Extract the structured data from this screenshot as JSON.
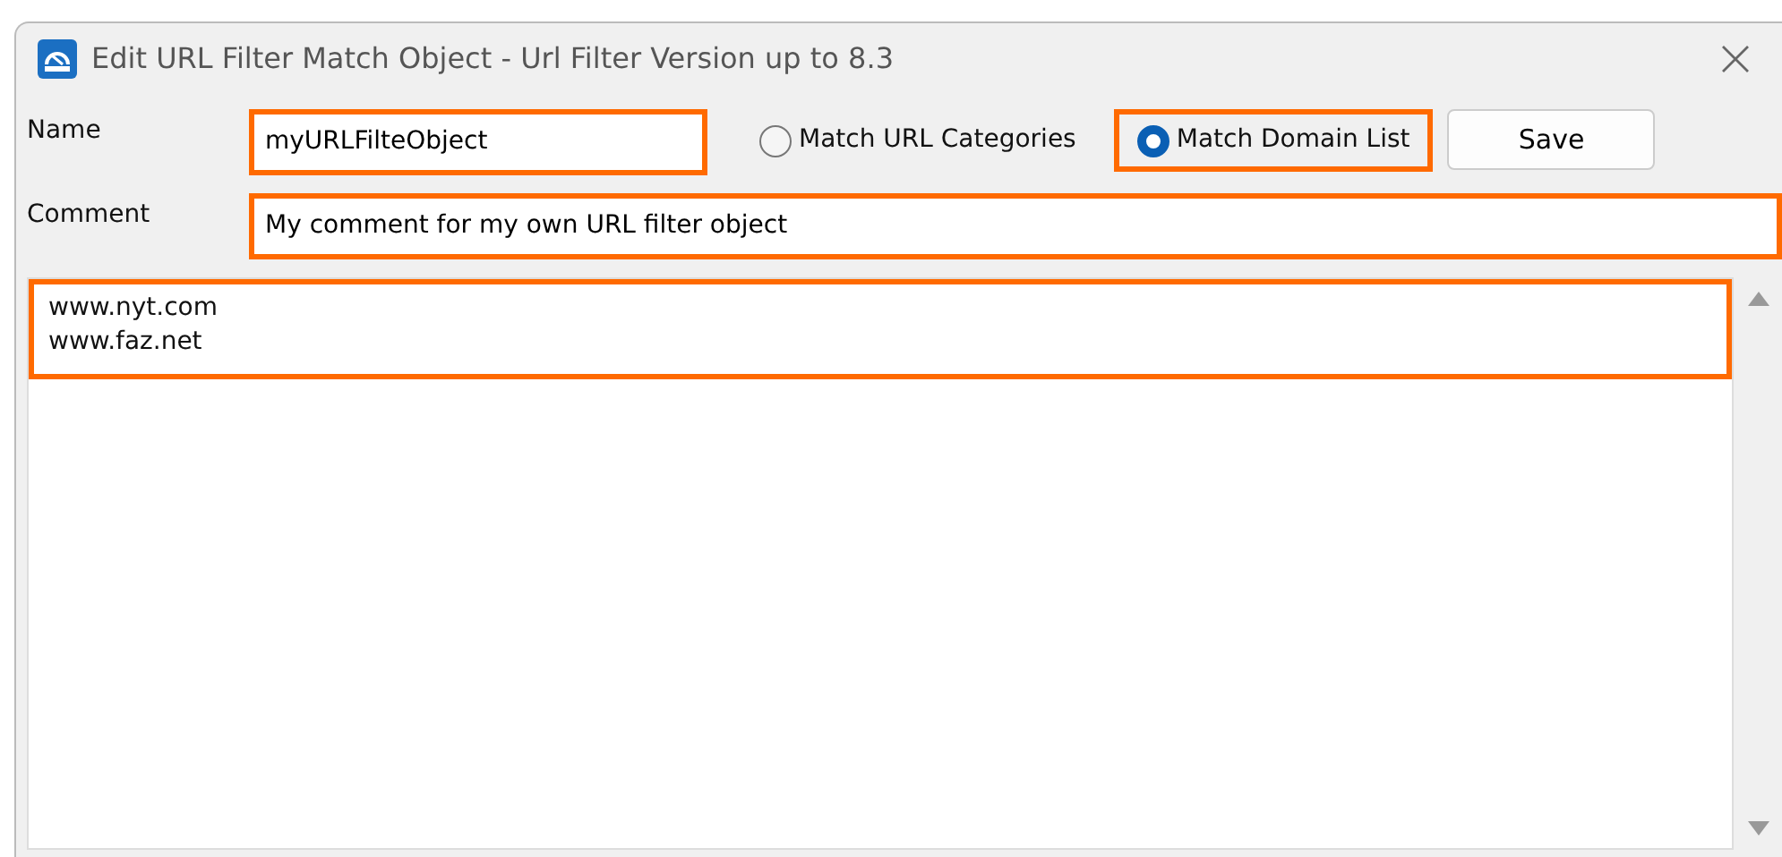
{
  "window": {
    "title": "Edit URL Filter Match Object - Url Filter Version up to 8.3"
  },
  "name_field": {
    "label": "Name",
    "value": "myURLFilteObject",
    "highlighted": true
  },
  "match_options": [
    {
      "label": "Match URL Categories",
      "selected": false,
      "highlighted": false
    },
    {
      "label": "Match Domain List",
      "selected": true,
      "highlighted": true
    }
  ],
  "save_button": "Save",
  "comment_field": {
    "label": "Comment",
    "value": "My comment for my own URL filter object",
    "highlighted": true
  },
  "domain_list": {
    "highlighted": true,
    "entries": [
      "www.nyt.com",
      "www.faz.net"
    ]
  }
}
